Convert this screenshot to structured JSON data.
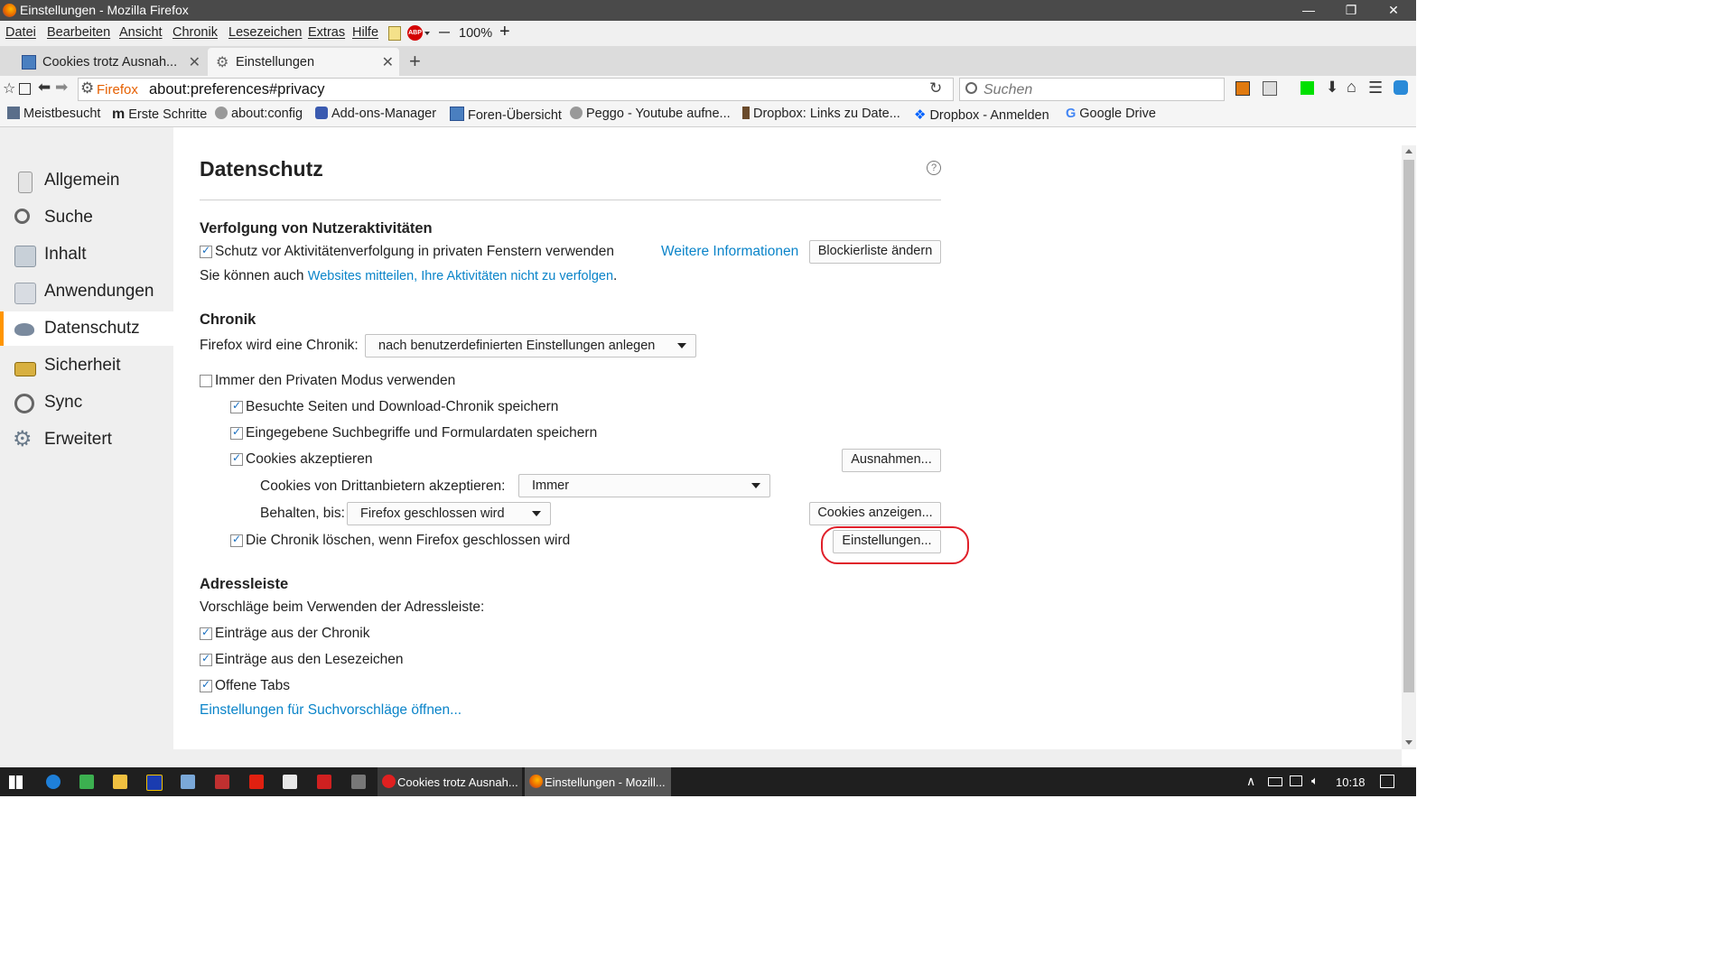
{
  "window": {
    "title": "Einstellungen - Mozilla Firefox",
    "min_glyph": "—",
    "restore_glyph": "❐",
    "close_glyph": "✕"
  },
  "menu": {
    "items": [
      "Datei",
      "Bearbeiten",
      "Ansicht",
      "Chronik",
      "Lesezeichen",
      "Extras",
      "Hilfe"
    ],
    "zoom_minus": "—",
    "zoom": "100%",
    "zoom_plus": "+"
  },
  "tabs": [
    {
      "label": "Cookies trotz Ausnah...",
      "close": "✕"
    },
    {
      "label": "Einstellungen",
      "close": "✕"
    }
  ],
  "new_tab": "+",
  "nav": {
    "identity": "Firefox",
    "url": "about:preferences#privacy",
    "search_placeholder": "Suchen"
  },
  "bookmarks": [
    {
      "label": "Meistbesucht"
    },
    {
      "label": "Erste Schritte"
    },
    {
      "label": "about:config"
    },
    {
      "label": "Add-ons-Manager"
    },
    {
      "label": "Foren-Übersicht"
    },
    {
      "label": "Peggo - Youtube aufne..."
    },
    {
      "label": "Dropbox: Links zu Date..."
    },
    {
      "label": "Dropbox - Anmelden"
    },
    {
      "label": "Google Drive"
    }
  ],
  "sidebar": {
    "items": [
      {
        "label": "Allgemein"
      },
      {
        "label": "Suche"
      },
      {
        "label": "Inhalt"
      },
      {
        "label": "Anwendungen"
      },
      {
        "label": "Datenschutz"
      },
      {
        "label": "Sicherheit"
      },
      {
        "label": "Sync"
      },
      {
        "label": "Erweitert"
      }
    ]
  },
  "page": {
    "title": "Datenschutz",
    "help_glyph": "?",
    "tracking": {
      "heading": "Verfolgung von Nutzeraktivitäten",
      "checkbox": "Schutz vor Aktivitätenverfolgung in privaten Fenstern verwenden",
      "more_info": "Weitere Informationen",
      "blocklist_button": "Blockierliste ändern",
      "text_prefix": "Sie können auch ",
      "dnt_link": "Websites mitteilen, Ihre Aktivitäten nicht zu verfolgen",
      "text_suffix": "."
    },
    "history": {
      "heading": "Chronik",
      "label": "Firefox wird eine Chronik:",
      "mode": "nach benutzerdefinierten Einstellungen anlegen",
      "private_mode": "Immer den Privaten Modus verwenden",
      "visited": "Besuchte Seiten und Download-Chronik speichern",
      "search_forms": "Eingegebene Suchbegriffe und Formulardaten speichern",
      "cookies": "Cookies akzeptieren",
      "exceptions_button": "Ausnahmen...",
      "third_party_label": "Cookies von Drittanbietern akzeptieren:",
      "third_party_value": "Immer",
      "keep_label": "Behalten, bis:",
      "keep_value": "Firefox geschlossen wird",
      "show_cookies_button": "Cookies anzeigen...",
      "clear_on_close": "Die Chronik löschen, wenn Firefox geschlossen wird",
      "settings_button": "Einstellungen..."
    },
    "addressbar": {
      "heading": "Adressleiste",
      "intro": "Vorschläge beim Verwenden der Adressleiste:",
      "from_history": "Einträge aus der Chronik",
      "from_bookmarks": "Einträge aus den Lesezeichen",
      "open_tabs": "Offene Tabs",
      "suggest_link": "Einstellungen für Suchvorschläge öffnen..."
    }
  },
  "taskbar": {
    "tasks": [
      {
        "label": "Cookies trotz Ausnah..."
      },
      {
        "label": "Einstellungen - Mozill..."
      }
    ],
    "time": "10:18",
    "tray_up": "∧"
  }
}
